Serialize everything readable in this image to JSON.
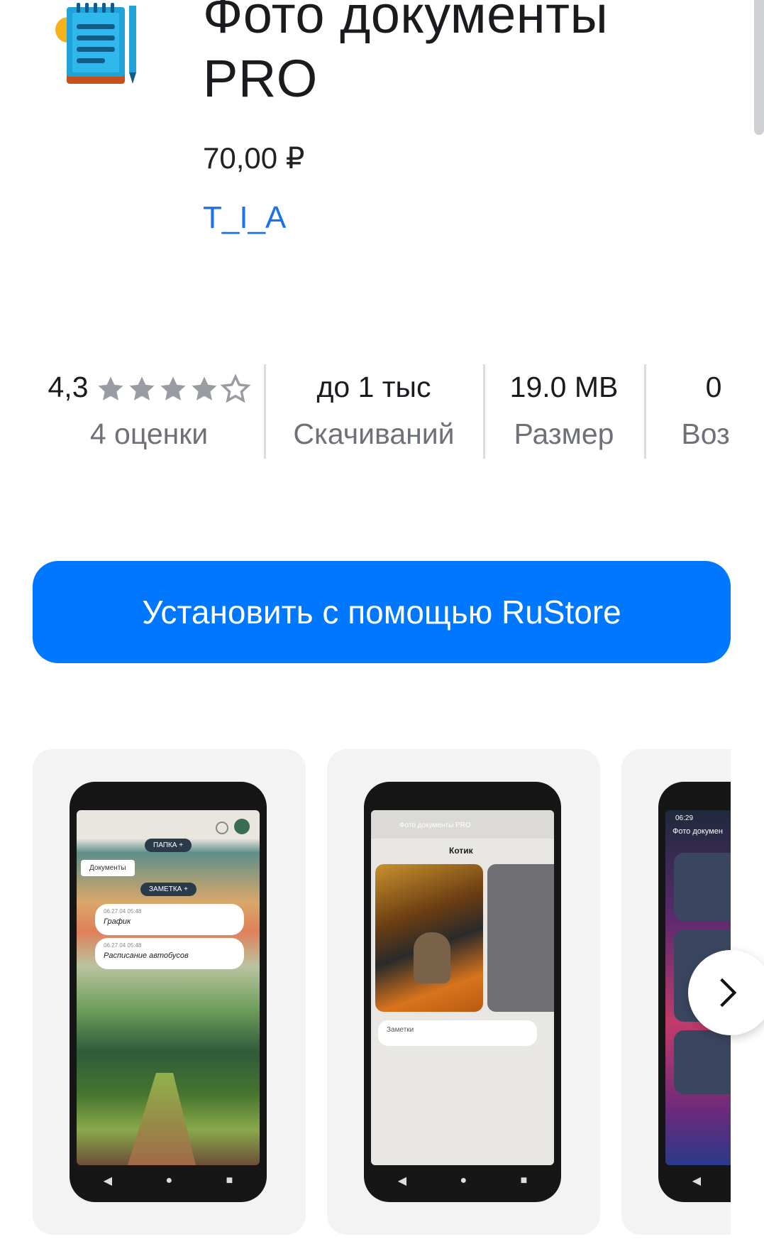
{
  "app": {
    "title": "Фото документы PRO",
    "price": "70,00 ₽",
    "developer": "T_I_A",
    "icon": "notepad-icon"
  },
  "stats": {
    "rating_value": "4,3",
    "rating_stars": 4.3,
    "rating_count": "4 оценки",
    "downloads_value": "до 1 тыс",
    "downloads_label": "Скачиваний",
    "size_value": "19.0 MB",
    "size_label": "Размер",
    "age_value": "0",
    "age_label": "Возр"
  },
  "install": {
    "label": "Установить с помощью RuStore"
  },
  "screenshots": [
    {
      "pill1": "ПАПКА +",
      "folder": "Документы",
      "pill2": "ЗАМЕТКА +",
      "notes": [
        {
          "date": "06.27.04 05:48",
          "title": "График"
        },
        {
          "date": "06.27.04 05:48",
          "title": "Расписание автобусов"
        }
      ]
    },
    {
      "header": "Фото документы PRO",
      "photo_title": "Котик",
      "field": "Заметки"
    },
    {
      "time": "06:29",
      "header": "Фото докумен"
    }
  ],
  "colors": {
    "accent": "#0077ff",
    "link": "#1a73e8",
    "star": "#9a9ca3"
  }
}
